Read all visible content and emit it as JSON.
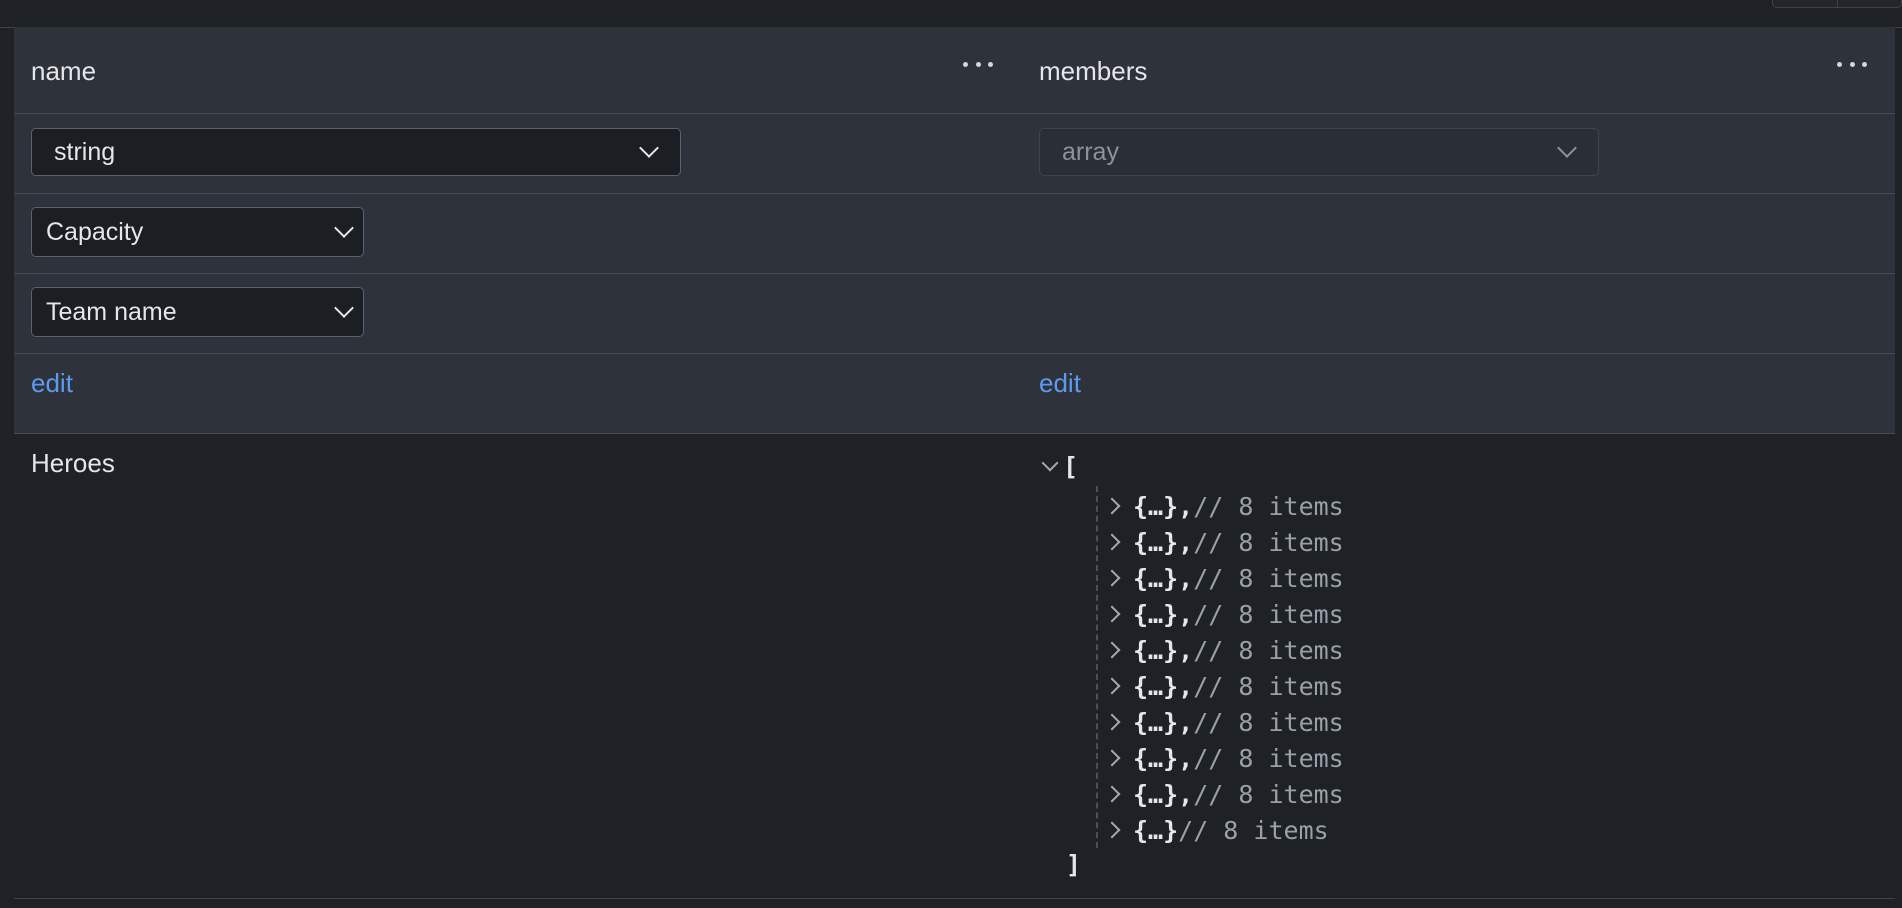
{
  "columns": [
    {
      "title": "name",
      "type": "string",
      "filter1": "Capacity",
      "filter2": "Team name",
      "edit_label": "edit",
      "value": "Heroes"
    },
    {
      "title": "members",
      "type": "array",
      "edit_label": "edit",
      "value": {
        "open_bracket": "[",
        "close_bracket": "]",
        "items": [
          {
            "label": "{…}",
            "sep": ",",
            "comment": "// 8 items"
          },
          {
            "label": "{…}",
            "sep": ",",
            "comment": "// 8 items"
          },
          {
            "label": "{…}",
            "sep": ",",
            "comment": "// 8 items"
          },
          {
            "label": "{…}",
            "sep": ",",
            "comment": "// 8 items"
          },
          {
            "label": "{…}",
            "sep": ",",
            "comment": "// 8 items"
          },
          {
            "label": "{…}",
            "sep": ",",
            "comment": "// 8 items"
          },
          {
            "label": "{…}",
            "sep": ",",
            "comment": "// 8 items"
          },
          {
            "label": "{…}",
            "sep": ",",
            "comment": "// 8 items"
          },
          {
            "label": "{…}",
            "sep": ",",
            "comment": "// 8 items"
          },
          {
            "label": "{…}",
            "sep": "",
            "comment": "// 8 items"
          }
        ]
      }
    }
  ],
  "colors": {
    "background": "#1e2126",
    "header_row": "#2e323a",
    "link": "#5b9bef",
    "comment": "#9aa0a8"
  },
  "icons": {
    "column_menu": "more-horizontal-icon",
    "dropdown": "chevron-down-icon",
    "expand": "chevron-right-icon",
    "collapse": "chevron-down-icon"
  }
}
